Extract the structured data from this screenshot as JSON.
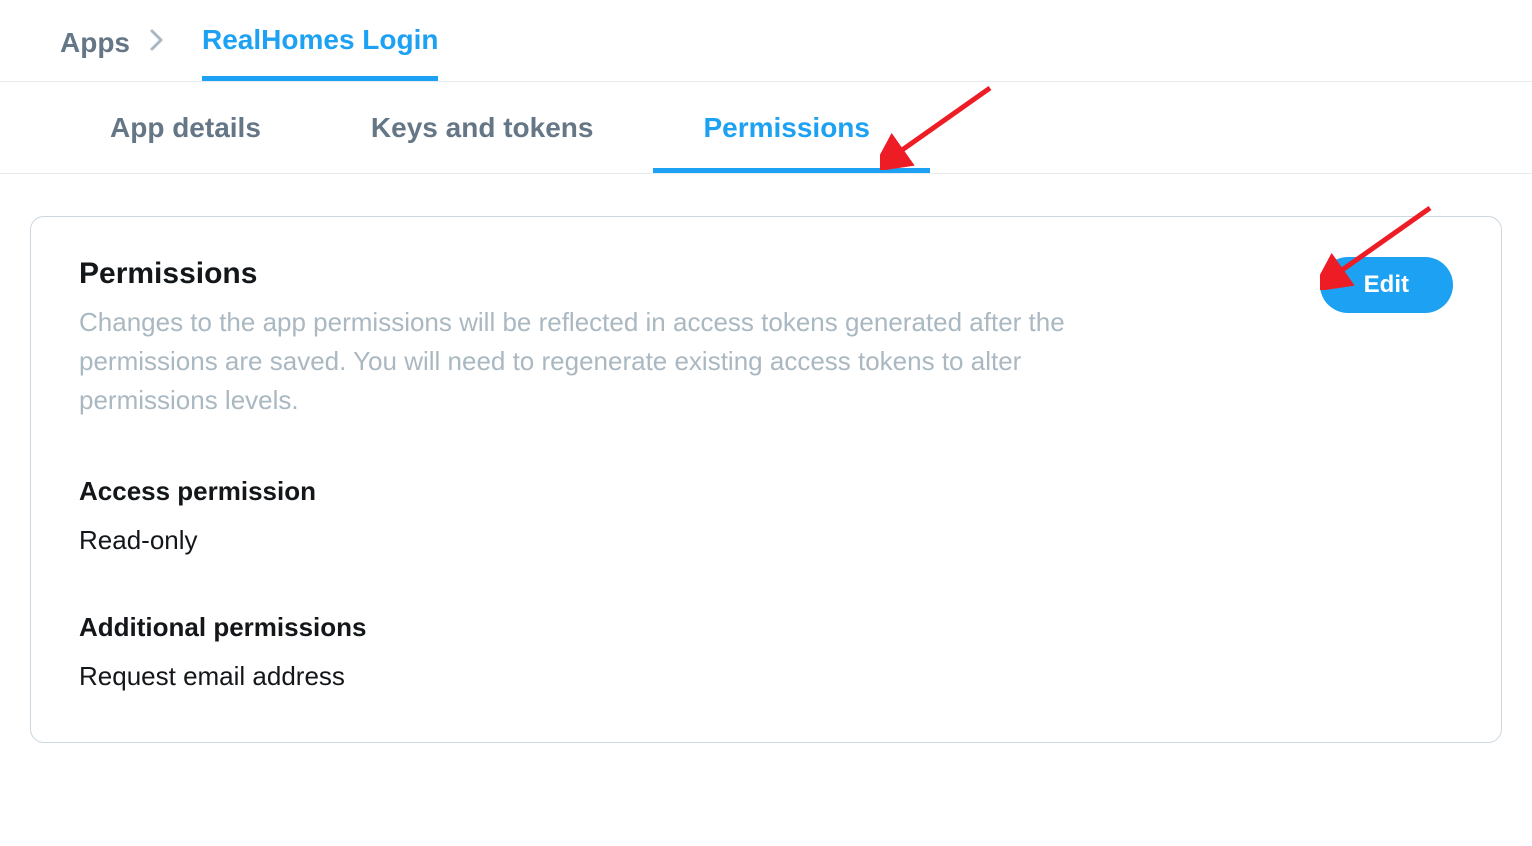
{
  "breadcrumb": {
    "root": "Apps",
    "current": "RealHomes Login"
  },
  "tabs": [
    {
      "label": "App details",
      "active": false
    },
    {
      "label": "Keys and tokens",
      "active": false
    },
    {
      "label": "Permissions",
      "active": true
    }
  ],
  "permissions": {
    "title": "Permissions",
    "description": "Changes to the app permissions will be reflected in access tokens generated after the permissions are saved. You will need to regenerate existing access tokens to alter permissions levels.",
    "edit_label": "Edit",
    "sections": [
      {
        "heading": "Access permission",
        "value": "Read-only"
      },
      {
        "heading": "Additional permissions",
        "value": "Request email address"
      }
    ]
  },
  "colors": {
    "accent": "#1da1f2",
    "text_muted": "#657786",
    "text_light": "#aab8c2",
    "border": "#e6ecf0",
    "card_border": "#ccd6dd",
    "annotation_arrow": "#ee1c25"
  }
}
